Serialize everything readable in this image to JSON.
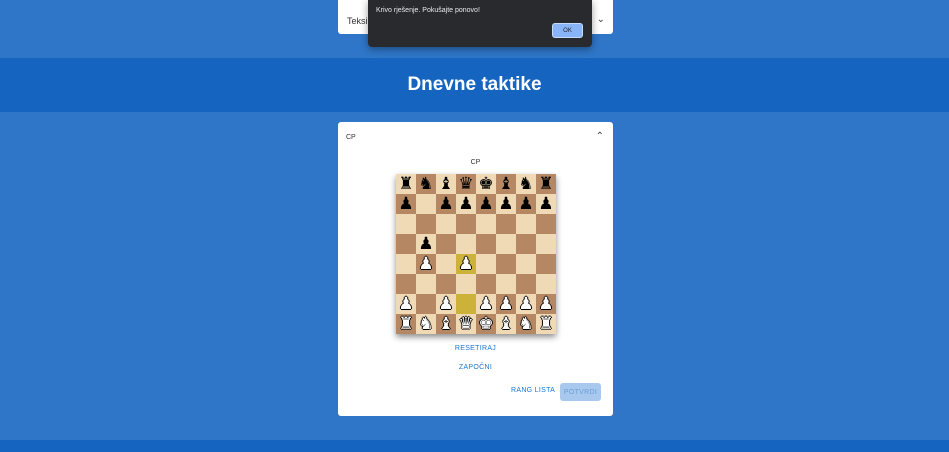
{
  "top_card": {
    "label": "Teksi",
    "chevron": "chevron-down-icon"
  },
  "dialog": {
    "message": "Krivo rješenje. Pokušajte ponovo!",
    "ok_label": "OK"
  },
  "banner": {
    "title": "Dnevne taktike"
  },
  "card": {
    "header_label": "CP",
    "chevron": "chevron-up-icon",
    "board_label": "CP",
    "reset_label": "RESETIRAJ",
    "start_label": "ZAPOČNI",
    "rank_label": "RANG LISTA",
    "confirm_label": "POTVRDI"
  },
  "board": {
    "rows": [
      [
        "♜",
        "♞",
        "♝",
        "♛",
        "♚",
        "♝",
        "♞",
        "♜"
      ],
      [
        "♟",
        "",
        "♟",
        "♟",
        "♟",
        "♟",
        "♟",
        "♟"
      ],
      [
        "",
        "",
        "",
        "",
        "",
        "",
        "",
        ""
      ],
      [
        "",
        "♟",
        "",
        "",
        "",
        "",
        "",
        ""
      ],
      [
        "",
        "♙",
        "",
        "♙",
        "",
        "",
        "",
        ""
      ],
      [
        "",
        "",
        "",
        "",
        "",
        "",
        "",
        ""
      ],
      [
        "♙",
        "",
        "♙",
        "",
        "♙",
        "♙",
        "♙",
        "♙"
      ],
      [
        "♖",
        "♘",
        "♗",
        "♕",
        "♔",
        "♗",
        "♘",
        "♖"
      ]
    ],
    "highlight": [
      [
        4,
        3
      ],
      [
        6,
        3
      ]
    ]
  }
}
